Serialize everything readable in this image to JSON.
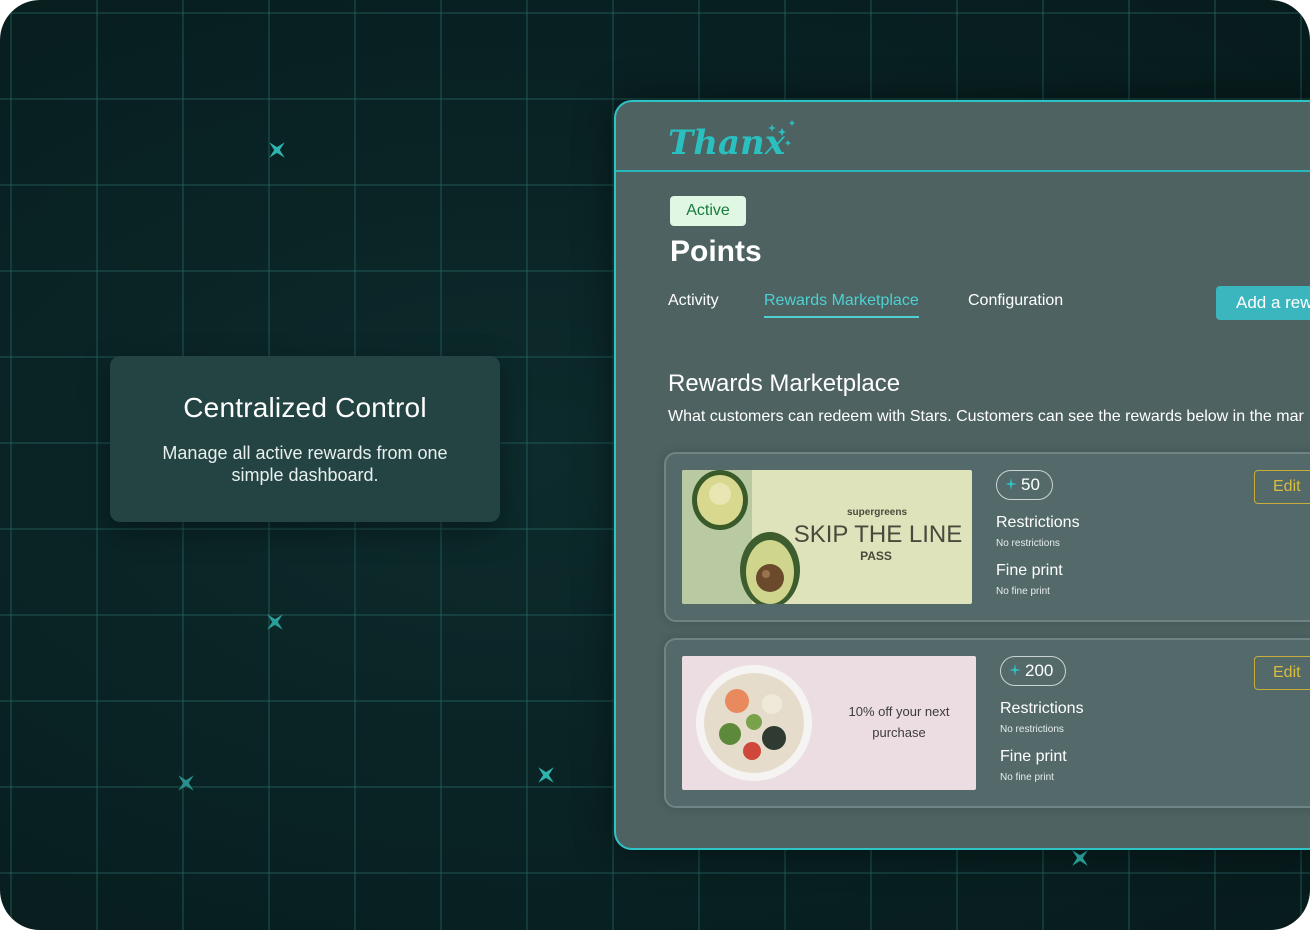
{
  "colors": {
    "accent": "#2ec4c6",
    "tab_active": "#4fd1d3",
    "edit": "#d9bd3c",
    "badge_bg": "#dff7e3",
    "badge_text": "#197a3d"
  },
  "feature": {
    "title": "Centralized Control",
    "description": "Manage all active rewards from one simple dashboard."
  },
  "app": {
    "logo": "Thanx",
    "status_badge": "Active",
    "page_title": "Points",
    "tabs": [
      {
        "label": "Activity",
        "active": false
      },
      {
        "label": "Rewards Marketplace",
        "active": true
      },
      {
        "label": "Configuration",
        "active": false
      }
    ],
    "add_button_label": "Add a rew"
  },
  "section": {
    "title": "Rewards Marketplace",
    "description": "What customers can redeem with Stars. Customers can see the rewards below in the mar"
  },
  "rewards": [
    {
      "image": {
        "brand": "supergreens",
        "line1": "SKIP THE LINE",
        "line2": "PASS"
      },
      "cost": "50",
      "restrictions_label": "Restrictions",
      "restrictions_value": "No restrictions",
      "fine_print_label": "Fine print",
      "fine_print_value": "No fine print",
      "edit_label": "Edit"
    },
    {
      "image": {
        "line1": "10% off your next",
        "line2": "purchase"
      },
      "cost": "200",
      "restrictions_label": "Restrictions",
      "restrictions_value": "No restrictions",
      "fine_print_label": "Fine print",
      "fine_print_value": "No fine print",
      "edit_label": "Edit"
    }
  ]
}
